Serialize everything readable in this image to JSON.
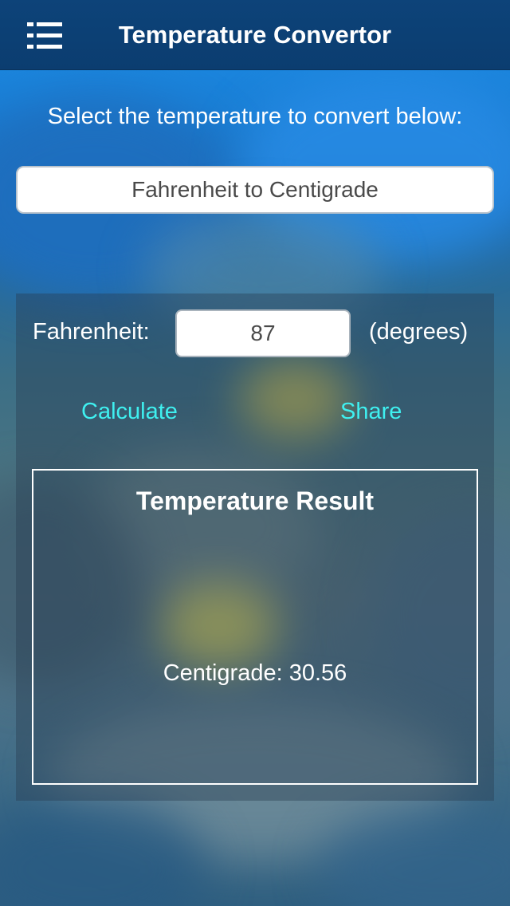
{
  "nav": {
    "title": "Temperature Convertor",
    "menu_icon": "list-menu-icon"
  },
  "instruction": "Select the temperature to convert below:",
  "conversion_selector": {
    "selected": "Fahrenheit to Centigrade"
  },
  "input": {
    "label": "Fahrenheit:",
    "value": "87",
    "unit": "(degrees)"
  },
  "actions": {
    "calculate_label": "Calculate",
    "share_label": "Share"
  },
  "result": {
    "title": "Temperature Result",
    "value_text": "Centigrade: 30.56"
  },
  "colors": {
    "nav_bar": "#0b3d70",
    "link_accent": "#3ff0f0"
  }
}
